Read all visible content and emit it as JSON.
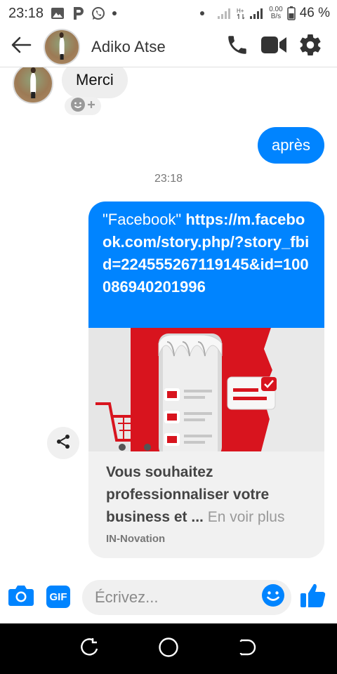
{
  "status_bar": {
    "time": "23:18",
    "net_speed_value": "0.00",
    "net_speed_unit": "B/s",
    "battery": "46 %",
    "icons": [
      "image-icon",
      "p-app-icon",
      "whatsapp-icon",
      "dot-icon",
      "dot-icon",
      "signal-icon",
      "h-plus-icon",
      "signal-icon",
      "battery-icon"
    ]
  },
  "header": {
    "contact_name": "Adiko Atse",
    "icons": [
      "back-arrow-icon",
      "phone-icon",
      "video-icon",
      "gear-icon"
    ]
  },
  "thread": {
    "incoming_message": "Merci",
    "outgoing_message": "après",
    "timestamp": "23:18",
    "shared_post": {
      "text_prefix": "\"Facebook\" ",
      "link": "https://m.facebook.com/story.php/?story_fbid=224555267119145&id=100086940201996",
      "title": "Vous souhaitez professionnaliser votre business et ...",
      "see_more": "En voir plus",
      "source": "IN-Novation"
    }
  },
  "composer": {
    "placeholder": "Écrivez...",
    "gif_label": "GIF",
    "icons": [
      "camera-icon",
      "gif-icon",
      "emoji-icon",
      "thumbs-up-icon"
    ]
  },
  "colors": {
    "accent": "#0084ff",
    "bubble_incoming": "#eeeeee",
    "card_footer": "#f1f1f1"
  },
  "nav_bar": {
    "icons": [
      "recent-apps-icon",
      "home-icon",
      "back-icon"
    ]
  }
}
